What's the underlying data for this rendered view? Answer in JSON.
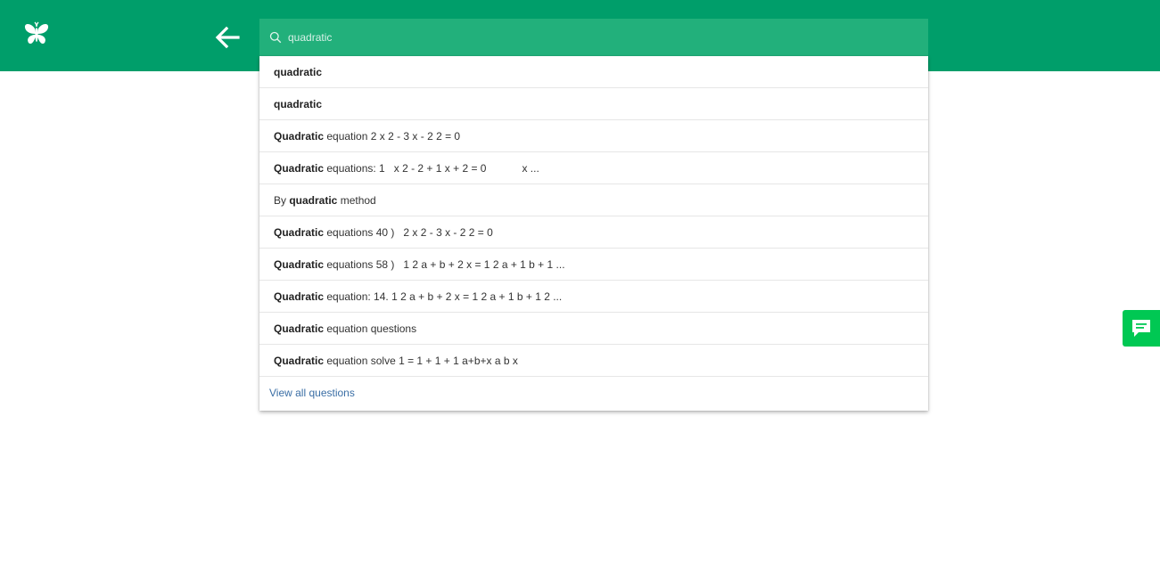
{
  "header": {
    "logo_icon": "butterfly-logo-icon",
    "back_icon": "arrow-left-icon",
    "brand_color": "#009e6a"
  },
  "search": {
    "icon": "search-icon",
    "value": "quadratic",
    "placeholder": "quadratic"
  },
  "suggestions": [
    {
      "bold": "quadratic",
      "rest": ""
    },
    {
      "bold": "quadratic",
      "rest": ""
    },
    {
      "bold": "Quadratic",
      "rest": " equation 2 x 2 - 3 x - 2 2 = 0"
    },
    {
      "bold": "Quadratic",
      "rest": " equations: 1   x 2 - 2 + 1 x + 2 = 0            x ..."
    },
    {
      "prefix": "By ",
      "bold": "quadratic",
      "rest": " method"
    },
    {
      "bold": "Quadratic",
      "rest": " equations 40 )   2 x 2 - 3 x - 2 2 = 0"
    },
    {
      "bold": "Quadratic",
      "rest": " equations 58 )   1 2 a + b + 2 x = 1 2 a + 1 b + 1 ..."
    },
    {
      "bold": "Quadratic",
      "rest": " equation: 14. 1 2 a + b + 2 x = 1 2 a + 1 b + 1 2 ..."
    },
    {
      "bold": "Quadratic",
      "rest": " equation questions"
    },
    {
      "bold": "Quadratic",
      "rest": " equation solve 1 = 1 + 1 + 1 a+b+x a b x"
    }
  ],
  "view_all_label": "View all questions",
  "chat": {
    "icon": "chat-bubble-icon",
    "color": "#00c853"
  }
}
